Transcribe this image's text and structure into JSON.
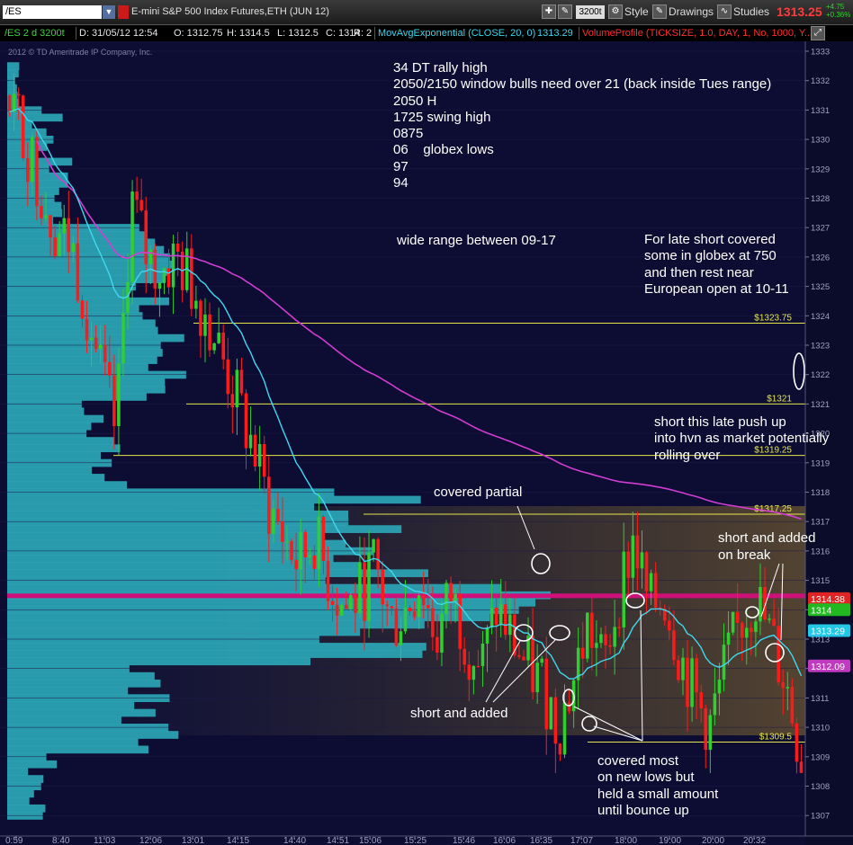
{
  "toolbar": {
    "symbol": "/ES",
    "contract": "E-mini S&P 500 Index Futures,ETH (JUN 12)",
    "aggregation": "3200t",
    "style_label": "Style",
    "drawings_label": "Drawings",
    "studies_label": "Studies",
    "last_price": "1313.25",
    "net_change": "+4.75",
    "pct_change": "+0.36%"
  },
  "info_bar": {
    "symbol_period": "/ES 2 d 3200t",
    "date": "D: 31/05/12 12:54",
    "open": "O: 1312.75",
    "high": "H: 1314.5",
    "low": "L: 1312.5",
    "close": "C: 1314",
    "range": "R: 2",
    "ma_study": "MovAvgExponential (CLOSE, 20, 0)",
    "ma_value": "1313.29",
    "vp_study": "VolumeProfile (TICKSIZE, 1.0, DAY, 1, No, 1000, Y..."
  },
  "colors": {
    "background": "#0d0d33",
    "up_candle": "#2fcf2f",
    "down_candle": "#ff1a1a",
    "ema_line": "#40d8f0",
    "vwap_line": "#d23cd2",
    "profile_fill": "#2ba6b6",
    "level_line": "#e6e64a",
    "annotation_text": "#ffffff"
  },
  "chart_data": {
    "type": "candlestick",
    "copyright": "2012 © TD Ameritrade IP Company, Inc.",
    "ylim": [
      1307,
      1333.5
    ],
    "y_ticks": [
      1307,
      1308,
      1309,
      1310,
      1311,
      1312,
      1313,
      1314,
      1315,
      1316,
      1317,
      1318,
      1319,
      1320,
      1321,
      1322,
      1323,
      1324,
      1325,
      1326,
      1327,
      1328,
      1329,
      1330,
      1331,
      1332,
      1333
    ],
    "x_ticks": [
      "0:59",
      "8:40",
      "11:03",
      "12:06",
      "13:01",
      "14:15",
      "14:40",
      "14:51",
      "15:06",
      "15:25",
      "15:46",
      "16:06",
      "16:35",
      "17:07",
      "18:00",
      "19:00",
      "20:00",
      "20:32"
    ],
    "trend": [
      1331.5,
      1330,
      1328.5,
      1327,
      1326.5,
      1324.5,
      1322,
      1320,
      1328,
      1326,
      1325.5,
      1326,
      1325,
      1324,
      1322.5,
      1321,
      1319.5,
      1317.5,
      1316.5,
      1315.5,
      1316.5,
      1315,
      1314,
      1314.5,
      1315.5,
      1313.5,
      1314,
      1315,
      1313,
      1314.5,
      1313,
      1312,
      1314,
      1313,
      1312,
      1311.5,
      1310,
      1311.5,
      1313.5,
      1312,
      1314.5,
      1316.5,
      1314,
      1314.5,
      1312.5,
      1311,
      1310,
      1312,
      1313.5,
      1314.5,
      1313,
      1311.5,
      1309
    ],
    "price_levels": [
      {
        "label": "$1323.75",
        "value": 1323.75
      },
      {
        "label": "$1321",
        "value": 1321
      },
      {
        "label": "$1319.25",
        "value": 1319.25
      },
      {
        "label": "$1317.25",
        "value": 1317.25
      },
      {
        "label": "$1309.5",
        "value": 1309.5
      }
    ],
    "price_bubbles": [
      {
        "label": "1314.38",
        "value": 1314.38,
        "color": "#e02424"
      },
      {
        "label": "1314",
        "value": 1314,
        "color": "#22b822"
      },
      {
        "label": "1313.29",
        "value": 1313.29,
        "color": "#22c8e6"
      },
      {
        "label": "1312.09",
        "value": 1312.09,
        "color": "#c03ac0"
      }
    ],
    "annotations": {
      "levels_note": [
        "34 DT rally high",
        "2050/2150 window bulls need over 21 (back inside Tues range)",
        "2050 H",
        "1725 swing high",
        "0875",
        "06    globex lows",
        "97",
        "94"
      ],
      "range_note": "wide range between 09-17",
      "late_short_note": [
        "For late short covered",
        "some in globex at 750",
        "and then rest near",
        "European open at 10-11"
      ],
      "short_push_note": [
        "short this late push up",
        "into hvn as market potentially",
        "rolling over"
      ],
      "covered_partial": "covered partial",
      "short_added_break": [
        "short and added",
        "on break"
      ],
      "short_added": "short and added",
      "covered_most": [
        "covered most",
        "on new lows but",
        "held a small amount",
        "until bounce up"
      ]
    }
  }
}
